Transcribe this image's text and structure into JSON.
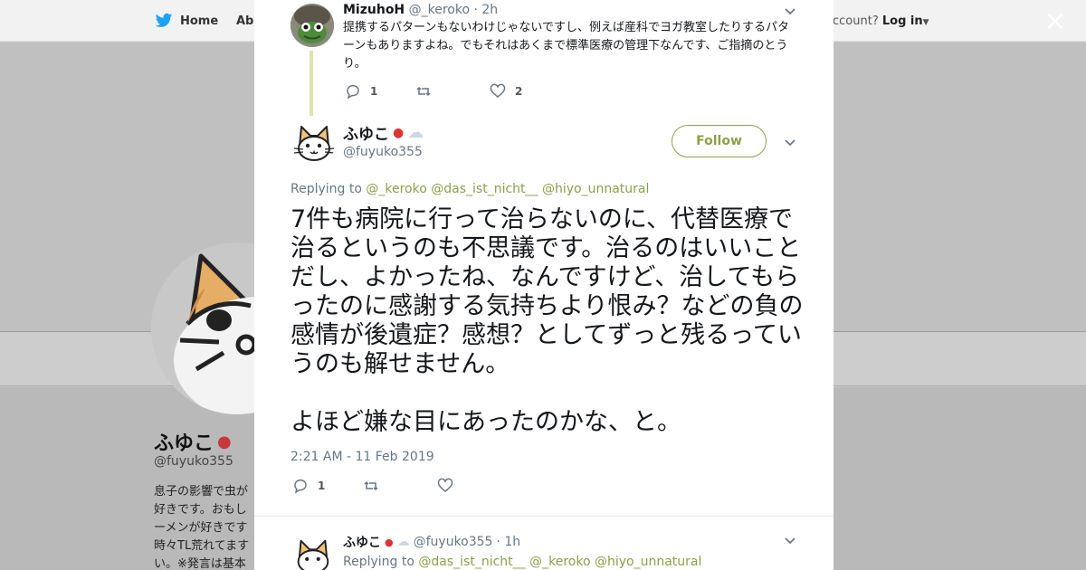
{
  "background": {
    "nav": {
      "home_label": "Home",
      "about_label": "Abo",
      "account_prompt": "ccount?",
      "login_label": "Log in"
    },
    "profile": {
      "name": "ふゆこ",
      "handle": "@fuyuko355",
      "bio_lines": [
        "息子の影響で虫が",
        "好きです。おもし",
        "ーメンが好きです",
        "時々TL荒れてます",
        "い。※発言は基本"
      ]
    }
  },
  "close_label": "×",
  "parent_tweet": {
    "name": "MizuhoH",
    "handle": "@_keroko",
    "time": "· 2h",
    "text": "提携するパターンもないわけじゃないですし、例えば産科でヨガ教室したりするパターンもありますよね。でもそれはあくまで標準医療の管理下なんです、ご指摘のとうり。",
    "reply_count": "1",
    "like_count": "2"
  },
  "main_tweet": {
    "name": "ふゆこ",
    "handle": "@fuyuko355",
    "follow_label": "Follow",
    "replying_label": "Replying to",
    "replying_to": [
      "@_keroko",
      "@das_ist_nicht__",
      "@hiyo_unnatural"
    ],
    "text": "7件も病院に行って治らないのに、代替医療で治るというのも不思議です。治るのはいいことだし、よかったね、なんですけど、治してもらったのに感謝する気持ちより恨み？などの負の感情が後遺症？感想？としてずっと残るっていうのも解せません。\n\nよほど嫌な目にあったのかな、と。",
    "timestamp": "2:21 AM - 11 Feb 2019",
    "reply_count": "1"
  },
  "reply_tweet": {
    "name": "ふゆこ",
    "handle": "@fuyuko355",
    "time": "· 1h",
    "replying_label": "Replying to",
    "replying_to": [
      "@das_ist_nicht__",
      "@_keroko",
      "@hiyo_unnatural"
    ]
  },
  "colors": {
    "accent": "#8ba04a",
    "twitter_blue": "#1da1f2",
    "overlay": "#c6c6c6"
  }
}
